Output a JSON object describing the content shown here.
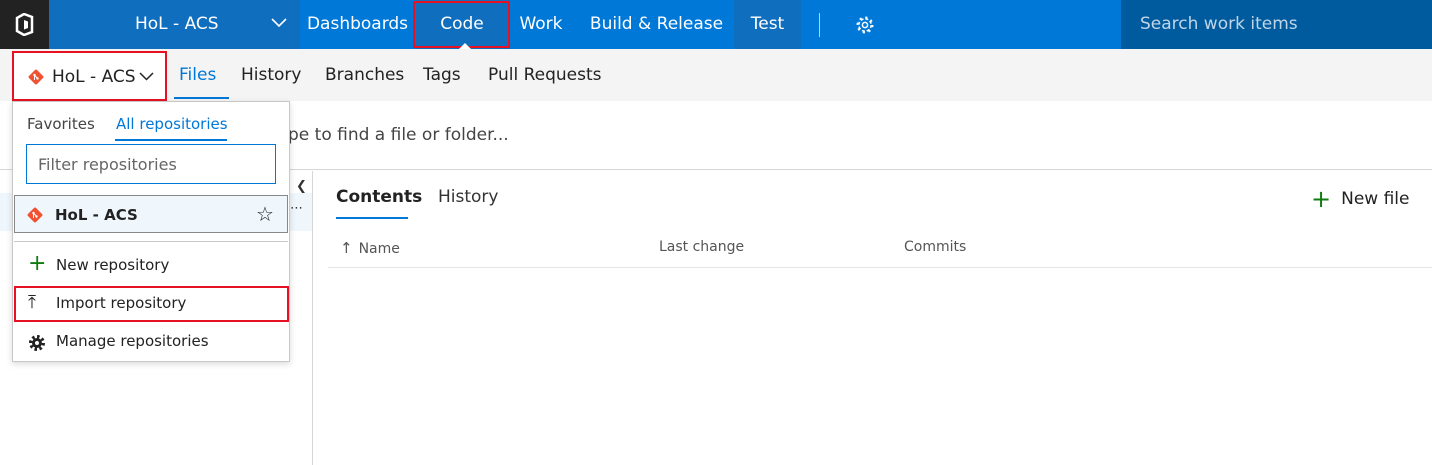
{
  "topbar": {
    "project": "HoL - ACS",
    "nav": [
      "Dashboards",
      "Code",
      "Work",
      "Build & Release",
      "Test"
    ],
    "search_placeholder": "Search work items"
  },
  "subnav": {
    "repo_name": "HoL - ACS",
    "tabs": [
      "Files",
      "History",
      "Branches",
      "Tags",
      "Pull Requests"
    ],
    "active_tab": "Files"
  },
  "path_hint": "pe to find a file or folder...",
  "dropdown": {
    "tabs": [
      "Favorites",
      "All repositories"
    ],
    "active_tab": "All repositories",
    "filter_placeholder": "Filter repositories",
    "filter_value": "",
    "repos": [
      {
        "name": "HoL - ACS"
      }
    ],
    "actions": [
      "New repository",
      "Import repository",
      "Manage repositories"
    ]
  },
  "content": {
    "tabs": [
      "Contents",
      "History"
    ],
    "active_tab": "Contents",
    "new_file": "New file",
    "columns": [
      "Name",
      "Last change",
      "Commits"
    ]
  },
  "colors": {
    "topbar": "#0078d7",
    "active_nav": "#106ebe",
    "highlight_outline": "#e81123",
    "git_icon": "#f05133",
    "add_green": "#107c10"
  }
}
